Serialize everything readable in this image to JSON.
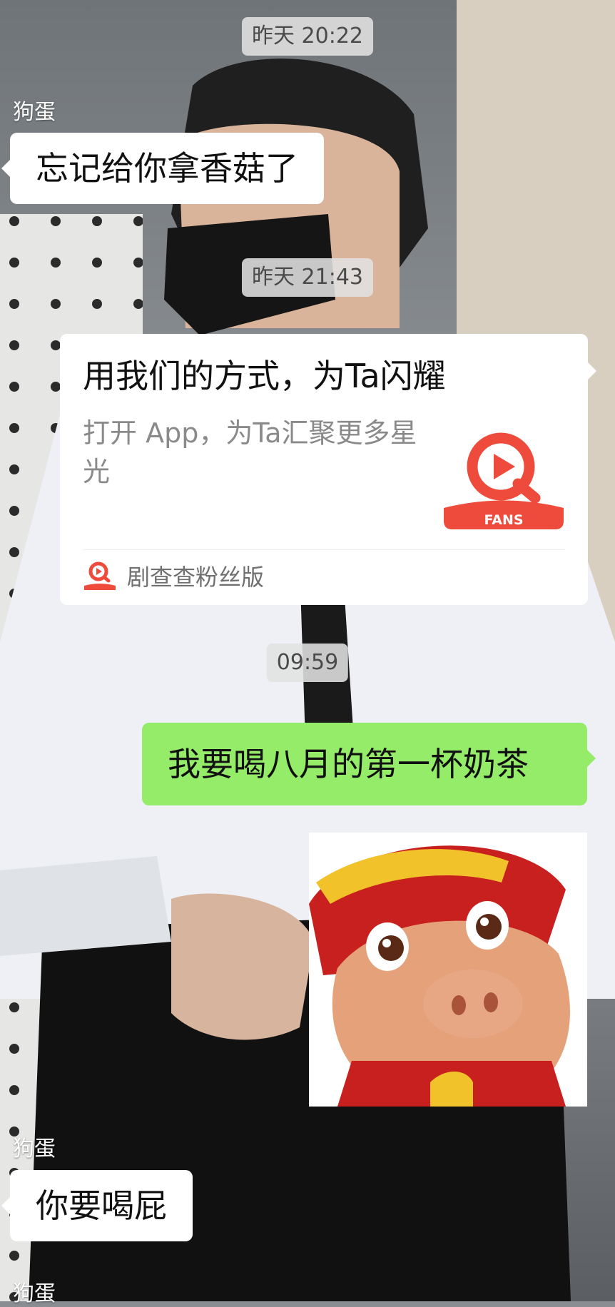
{
  "chat": {
    "ts1": "昨天 20:22",
    "ts2": "昨天 21:43",
    "ts3": "09:59",
    "sender1": "狗蛋",
    "sender2": "狗蛋",
    "sender3": "狗蛋",
    "msg1": "忘记给你拿香菇了",
    "msg2": "我要喝八月的第一杯奶茶",
    "msg3": "你要喝屁"
  },
  "card": {
    "title": "用我们的方式，为Ta闪耀",
    "description": "打开 App，为Ta汇聚更多星光",
    "logo_text": "FANS",
    "source": "剧查查粉丝版"
  },
  "colors": {
    "self_bubble": "#95ec69",
    "other_bubble": "#ffffff",
    "brand": "#ef4b3c"
  },
  "icons": {
    "card_logo": "fans-play-logo-icon",
    "sticker": "cartoon-pig-sticker"
  }
}
